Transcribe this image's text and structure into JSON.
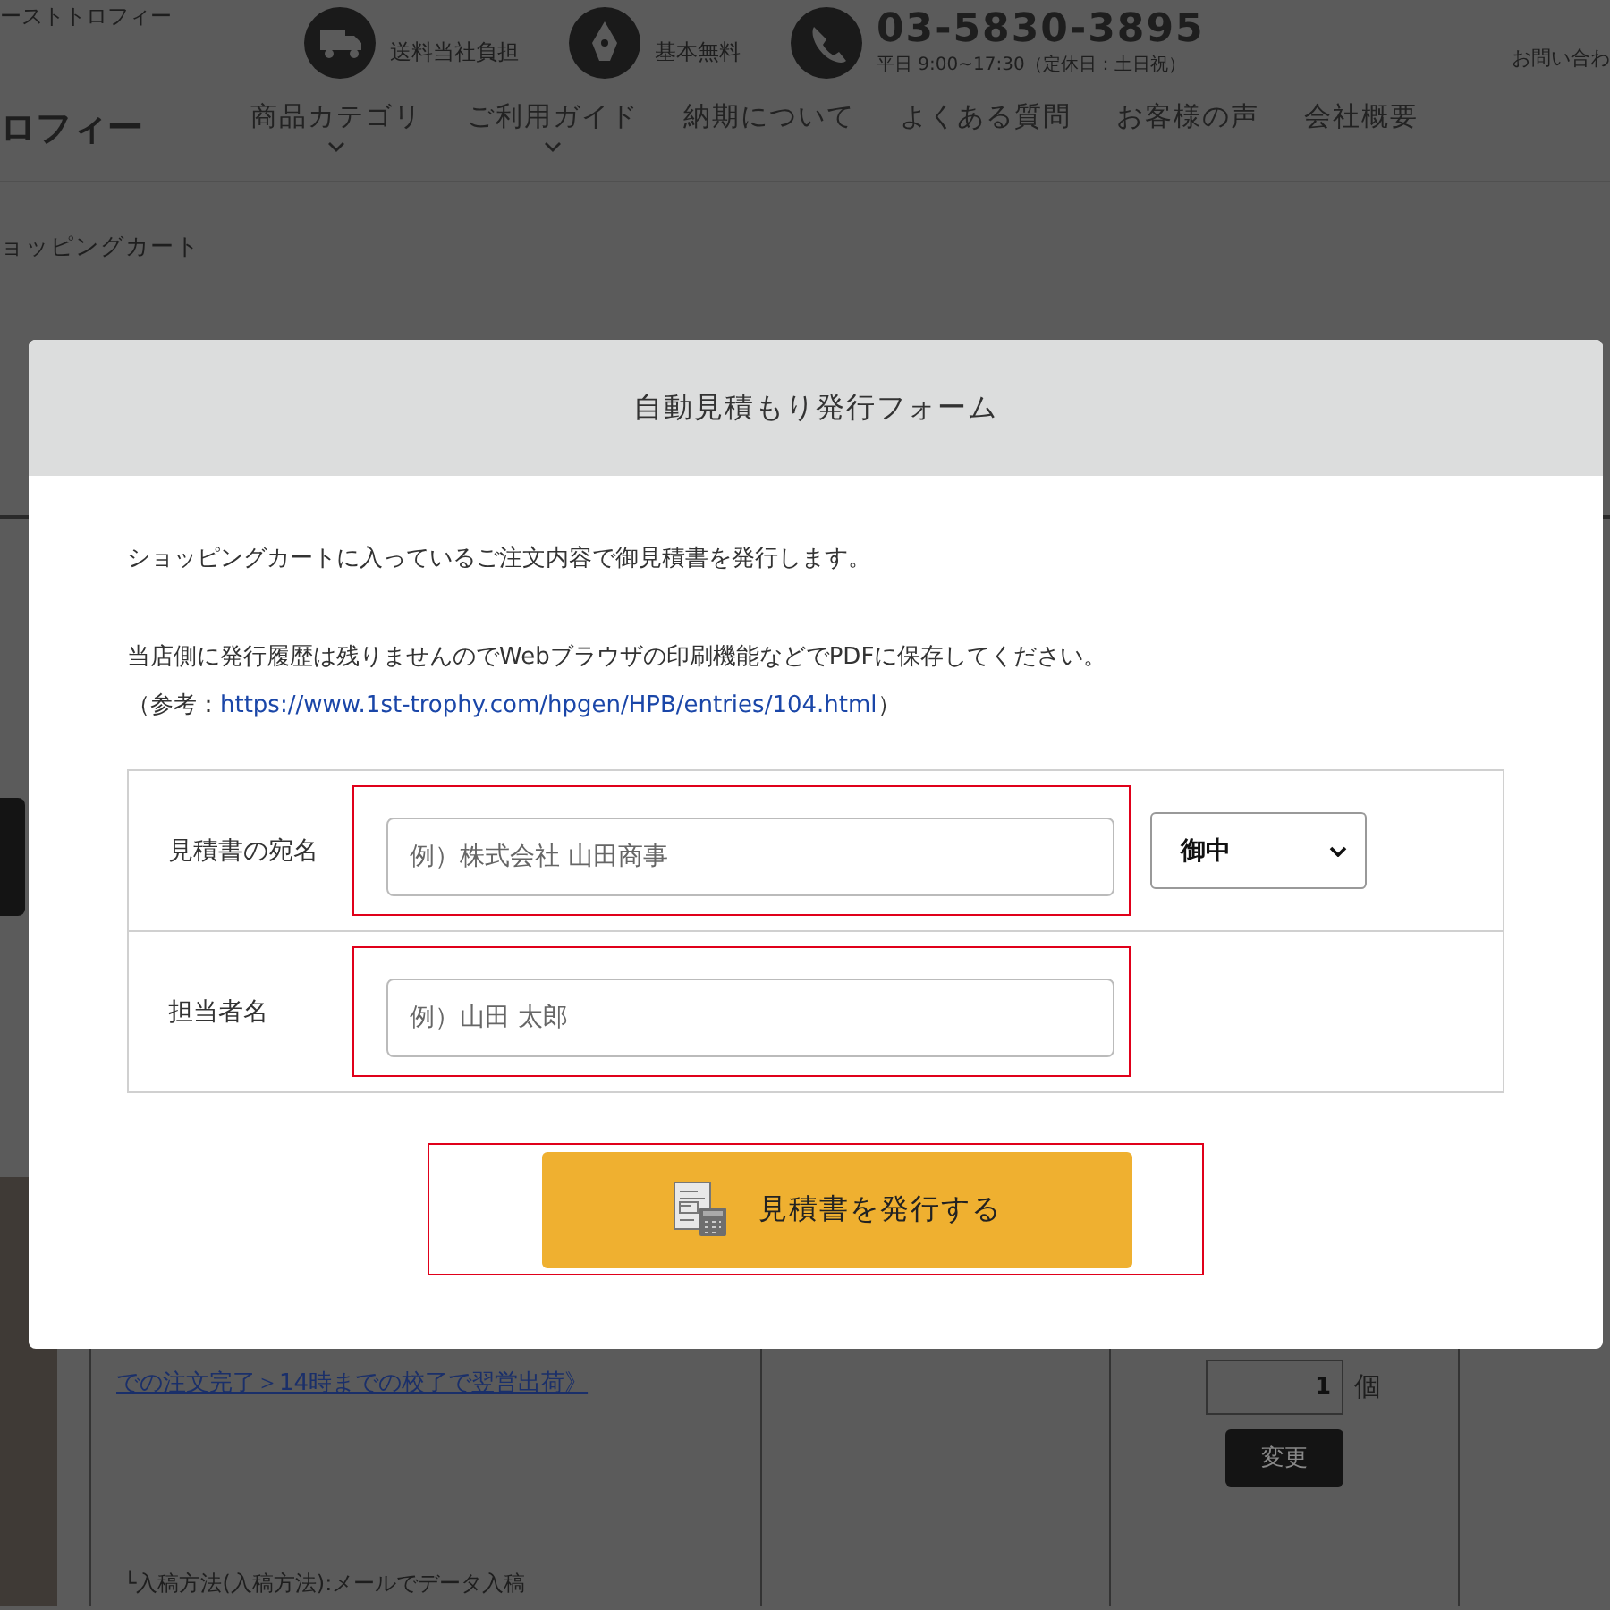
{
  "header": {
    "tagline": "ーストトロフィー",
    "features": [
      {
        "kind": "truck",
        "text": "送料当社負担"
      },
      {
        "kind": "pen",
        "text": "基本無料"
      }
    ],
    "phone": "03-5830-3895",
    "hours": "平日 9:00~17:30（定休日：土日祝）",
    "contact": "お問い合わ"
  },
  "logo": "ロフィー",
  "nav": [
    {
      "label": "商品カテゴリ",
      "dropdown": true
    },
    {
      "label": "ご利用ガイド",
      "dropdown": true
    },
    {
      "label": "納期について",
      "dropdown": false
    },
    {
      "label": "よくある質問",
      "dropdown": false
    },
    {
      "label": "お客様の声",
      "dropdown": false
    },
    {
      "label": "会社概要",
      "dropdown": false
    }
  ],
  "breadcrumb": "ョッピングカート",
  "cart": {
    "item_link": "での注文完了＞14時までの校了で翌営出荷》",
    "option": "└入稿方法(入稿方法):メールでデータ入稿",
    "quantity": "1",
    "unit": "個",
    "update_button": "変更"
  },
  "modal": {
    "title": "自動見積もり発行フォーム",
    "lines": [
      "ショッピングカートに入っているご注文内容で御見積書を発行します。",
      "当店側に発行履歴は残りませんのでWebブラウザの印刷機能などでPDFに保存してください。"
    ],
    "reference": {
      "prefix": "（参考：",
      "url": "https://www.1st-trophy.com/hpgen/HPB/entries/104.html",
      "suffix": "）"
    },
    "fields": [
      {
        "label": "見積書の宛名",
        "placeholder": "例）株式会社 山田商事",
        "select": "御中"
      },
      {
        "label": "担当者名",
        "placeholder": "例）山田 太郎"
      }
    ],
    "submit": "見積書を発行する"
  }
}
